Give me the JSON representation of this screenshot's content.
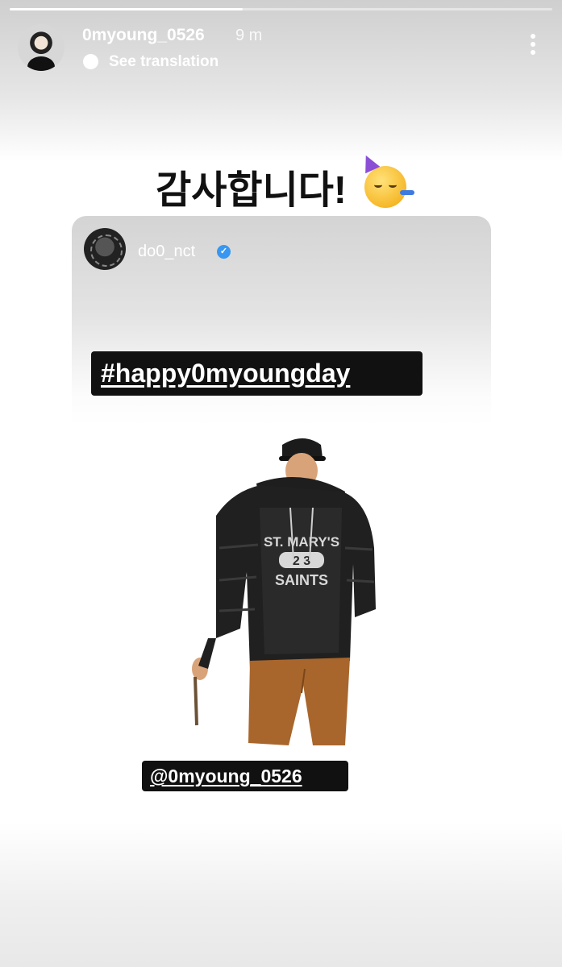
{
  "story": {
    "progress": 0.43
  },
  "header": {
    "username": "0myoung_0526",
    "time": "9 m",
    "see_translation": "See translation"
  },
  "caption": {
    "text": "감사합니다!",
    "emoji": "party-face-icon"
  },
  "shared_story": {
    "username": "do0_nct",
    "verified": true,
    "hashtag": "#happy0myoungday",
    "mention": "@0myoung_0526",
    "sweatshirt_text": [
      "ST. MARY'S",
      "2 3",
      "SAINTS"
    ]
  }
}
